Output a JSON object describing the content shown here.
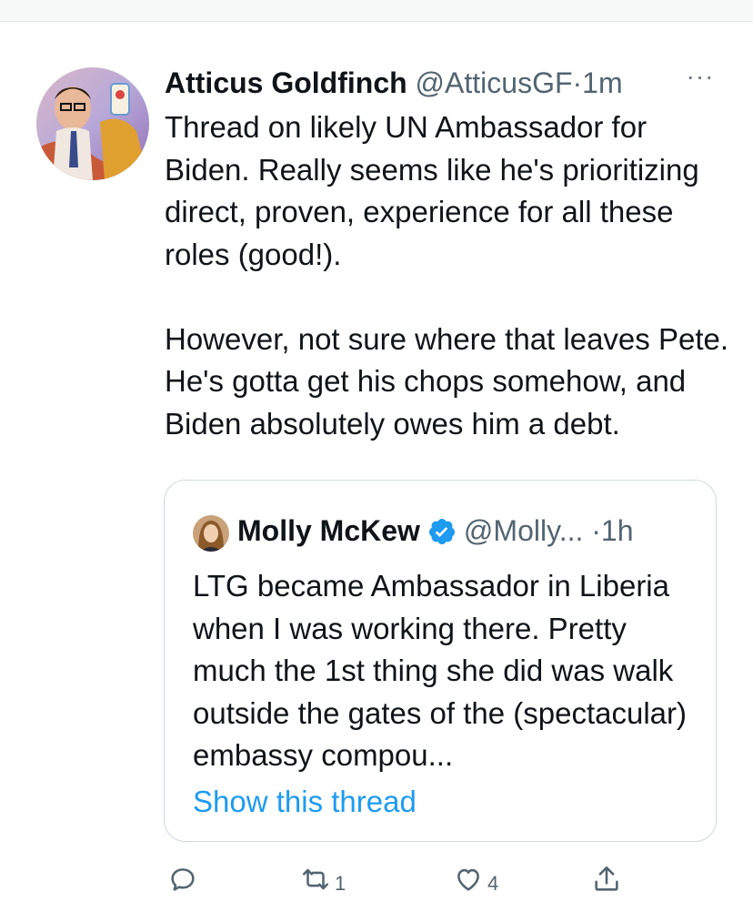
{
  "tweet": {
    "display_name": "Atticus Goldfinch",
    "handle": "@AtticusGF",
    "separator": "·",
    "time": "1m",
    "more_label": "···",
    "text": "Thread on likely UN Ambassador for Biden. Really seems like he's prioritizing direct, proven, experience for all these roles (good!).\n\nHowever, not sure where that leaves Pete. He's gotta get his chops somehow, and Biden absolutely owes him a debt."
  },
  "quoted_tweet": {
    "display_name": "Molly McKew",
    "handle": "@Molly...",
    "separator": "·",
    "time": "1h",
    "text": "LTG became Ambassador in Liberia when I was working there. Pretty much the 1st thing she did was walk outside the gates of the (spectacular) embassy compou...",
    "show_thread_label": "Show this thread"
  },
  "actions": {
    "reply_count": "",
    "retweet_count": "1",
    "like_count": "4"
  },
  "colors": {
    "link": "#1d9bf0",
    "verified": "#1d9bf0",
    "secondary_text": "#536471",
    "border": "#cfd9de"
  },
  "icons": [
    "reply-icon",
    "retweet-icon",
    "like-icon",
    "share-icon",
    "verified-badge-icon",
    "more-icon"
  ]
}
